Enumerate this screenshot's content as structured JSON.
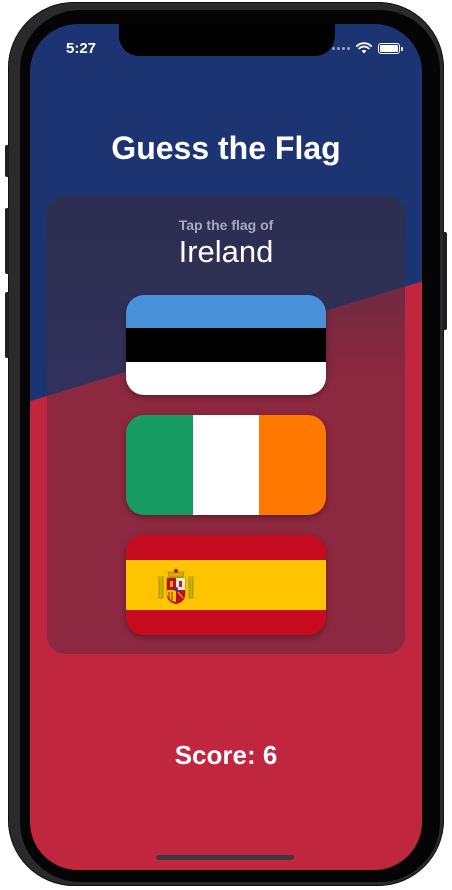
{
  "status_bar": {
    "time": "5:27",
    "signal_icon": "cellular-dots-icon",
    "wifi_icon": "wifi-icon",
    "battery_icon": "battery-icon"
  },
  "title": "Guess the Flag",
  "card": {
    "prompt": "Tap the flag of",
    "country": "Ireland"
  },
  "flags": [
    {
      "country": "Estonia",
      "colors": [
        "#4891d9",
        "#000000",
        "#ffffff"
      ]
    },
    {
      "country": "Ireland",
      "colors": [
        "#169b62",
        "#ffffff",
        "#ff7900"
      ]
    },
    {
      "country": "Spain",
      "colors": [
        "#c60b1e",
        "#ffc400",
        "#c60b1e"
      ]
    }
  ],
  "score_label": "Score: 6",
  "colors": {
    "background_top": "#1c3572",
    "background_bottom": "#c1263f",
    "card_bg": "#5b2a3a"
  }
}
